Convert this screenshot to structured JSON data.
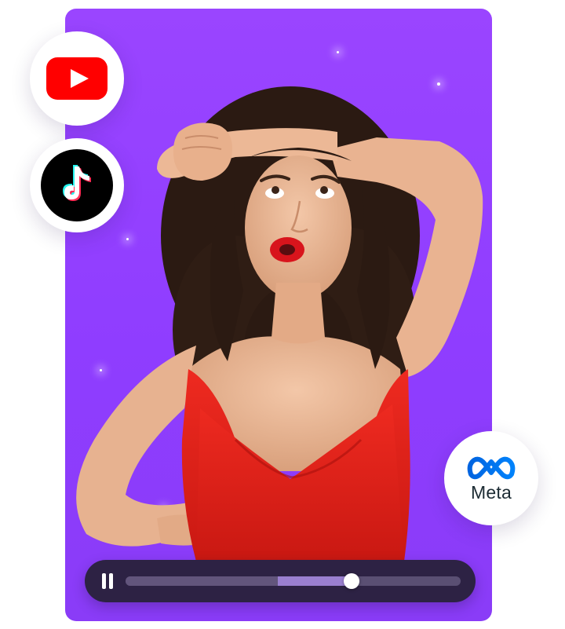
{
  "card": {
    "background": "#9a45ff"
  },
  "badges": {
    "youtube": {
      "icon": "youtube-icon",
      "color": "#ff0000"
    },
    "tiktok": {
      "icon": "tiktok-icon",
      "colors": [
        "#25f4ee",
        "#fe2c55",
        "#ffffff"
      ]
    },
    "meta": {
      "icon": "meta-infinity-icon",
      "label": "Meta",
      "color": "#0668e1"
    }
  },
  "person": {
    "dress_color": "#e2231a",
    "hair_color": "#2b1a12"
  },
  "player": {
    "state": "playing",
    "pause_icon": "pause-icon",
    "buffered_fraction": 0.7,
    "played_start_fraction": 0.455,
    "progress_fraction": 0.675
  }
}
